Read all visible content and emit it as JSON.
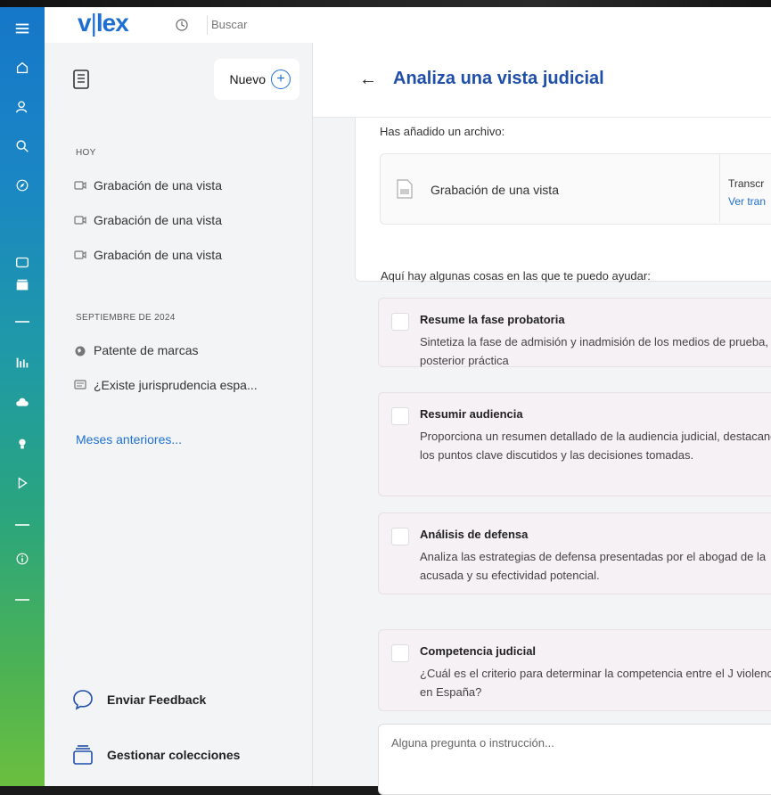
{
  "header": {
    "logo": "vlex",
    "search_placeholder": "Buscar"
  },
  "sidebar": {
    "nuevo_label": "Nuevo",
    "sections": [
      {
        "label": "HOY",
        "items": [
          {
            "label": "Grabación de una vista",
            "icon": "video-icon"
          },
          {
            "label": "Grabación de una vista",
            "icon": "video-icon"
          },
          {
            "label": "Grabación de una vista",
            "icon": "video-icon"
          }
        ]
      },
      {
        "label": "SEPTIEMBRE DE 2024",
        "items": [
          {
            "label": "Patente de marcas",
            "icon": "globe-icon"
          },
          {
            "label": "¿Existe jurisprudencia espa...",
            "icon": "chat-icon"
          }
        ]
      }
    ],
    "more_link": "Meses anteriores...",
    "feedback_label": "Enviar Feedback",
    "collections_label": "Gestionar colecciones"
  },
  "main": {
    "title": "Analiza una vista judicial",
    "file_heading": "Has añadido un archivo:",
    "file_name": "Grabación de una vista",
    "file_side_label": "Transcr",
    "file_side_link": "Ver tran",
    "help_intro": "Aquí hay algunas cosas en las que te puedo ayudar:",
    "suggestions": [
      {
        "title": "Resume la fase probatoria",
        "desc": "Sintetiza la fase de admisión y inadmisión de los medios de prueba, y su posterior práctica"
      },
      {
        "title": "Resumir audiencia",
        "desc": "Proporciona un resumen detallado de la audiencia judicial, destacando los puntos clave discutidos y las decisiones tomadas."
      },
      {
        "title": "Análisis de defensa",
        "desc": "Analiza las estrategias de defensa presentadas por el abogad de la acusada y su efectividad potencial."
      },
      {
        "title": "Competencia judicial",
        "desc": "¿Cuál es el criterio para determinar la competencia entre el J violencia en España?"
      }
    ],
    "question_placeholder": "Alguna pregunta o instrucción..."
  },
  "colors": {
    "brand": "#1f6fd0",
    "title": "#1f4fa8",
    "rail_top": "#1677c9",
    "rail_bottom": "#6bbf3f",
    "suggestion_bg": "#f6f1f4"
  }
}
